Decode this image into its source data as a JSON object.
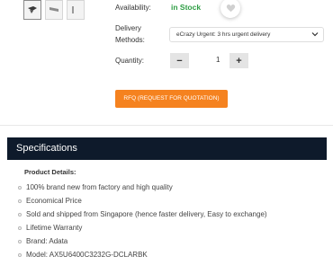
{
  "product": {
    "availability_label": "Availability:",
    "stock_status": "in Stock",
    "delivery_label_line1": "Delivery",
    "delivery_label_line2": "Methods:",
    "delivery_selected": "eCrazy Urgent: 3 hrs urgent delivery",
    "quantity_label": "Quantity:",
    "quantity_value": "1",
    "decrement_symbol": "−",
    "increment_symbol": "+",
    "rfq_label": "RFQ (REQUEST FOR QUOTATION)",
    "thumbnails": [
      "thumb-1",
      "thumb-2",
      "thumb-3"
    ]
  },
  "specifications": {
    "heading": "Specifications",
    "details_label": "Product Details:",
    "items": [
      "100% brand new from factory and high quality",
      "Economical Price",
      "Sold and shipped from Singapore (hence faster delivery, Easy to exchange)",
      "Lifetime Warranty",
      "Brand: Adata",
      "Model: AX5U6400C3232G-DCLARBK"
    ]
  },
  "colors": {
    "in_stock": "#2e9e44",
    "rfq_button": "#f5821f",
    "spec_header_bg": "#0e1a2b"
  },
  "icons": {
    "wishlist": "heart-icon",
    "dropdown": "chevron-down-icon"
  }
}
